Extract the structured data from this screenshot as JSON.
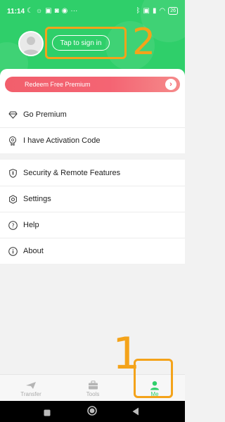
{
  "status_bar": {
    "time": "11:14",
    "left_icons": [
      "moon-icon",
      "brightness-icon",
      "app-icon",
      "gallery-icon",
      "game-icon",
      "more-dots"
    ],
    "more": "···",
    "right_icons": [
      "bluetooth-icon",
      "box-icon",
      "signal-icon",
      "wifi-icon"
    ],
    "battery": "26"
  },
  "header": {
    "signin_label": "Tap to sign in",
    "accent_color": "#2fcf6a"
  },
  "annotations": {
    "signin_number": "2",
    "me_tab_number": "1",
    "color": "#f4a31a"
  },
  "promo": {
    "label": "Redeem Free Premium"
  },
  "menu": {
    "go_premium": "Go Premium",
    "activation_code": "I have Activation Code",
    "security": "Security & Remote Features",
    "settings": "Settings",
    "help": "Help",
    "about": "About"
  },
  "tabbar": {
    "transfer": "Transfer",
    "tools": "Tools",
    "me": "Me"
  }
}
